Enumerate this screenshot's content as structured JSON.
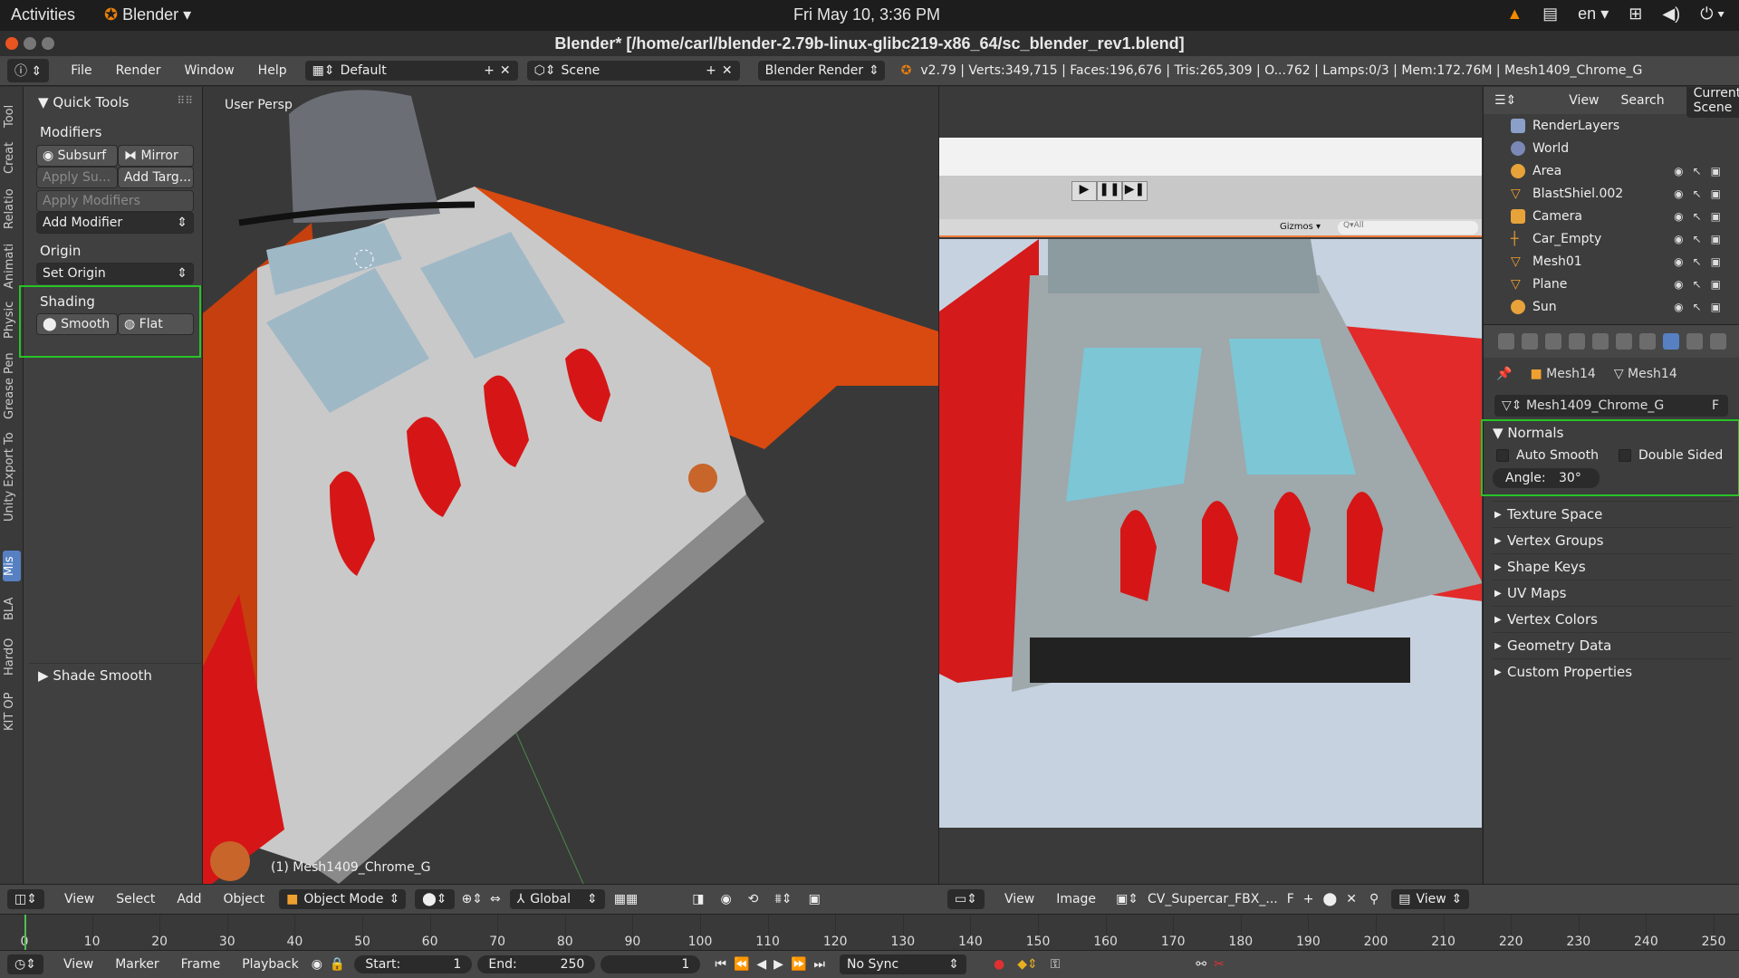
{
  "topbar": {
    "activities": "Activities",
    "app": "Blender",
    "clock": "Fri May 10,  3:36 PM",
    "lang": "en"
  },
  "window": {
    "title": "Blender* [/home/carl/blender-2.79b-linux-glibc219-x86_64/sc_blender_rev1.blend]"
  },
  "info": {
    "menus": [
      "File",
      "Render",
      "Window",
      "Help"
    ],
    "layout": "Default",
    "scene": "Scene",
    "engine": "Blender Render",
    "stats": "v2.79 | Verts:349,715 | Faces:196,676 | Tris:265,309 | O...762 | Lamps:0/3 | Mem:172.76M | Mesh1409_Chrome_G"
  },
  "tool_tabs": [
    "Tool",
    "Creat",
    "Relatio",
    "Animati",
    "Physic",
    "Grease Pen",
    "Unity Export To",
    "Mis",
    "BLA",
    "HardO",
    "KIT OP"
  ],
  "tool_tab_active": "Mis",
  "toolshelf": {
    "panel_title": "Quick Tools",
    "modifiers_label": "Modifiers",
    "subsurf": "Subsurf",
    "mirror": "Mirror",
    "apply_su": "Apply Su...",
    "add_targ": "Add Targ...",
    "apply_modifiers": "Apply Modifiers",
    "add_modifier": "Add Modifier",
    "origin_label": "Origin",
    "set_origin": "Set Origin",
    "shading_label": "Shading",
    "smooth": "Smooth",
    "flat": "Flat",
    "operator_panel": "Shade Smooth"
  },
  "viewport": {
    "view_label": "User Persp",
    "object_label": "(1) Mesh1409_Chrome_G"
  },
  "viewport_header": {
    "menus": [
      "View",
      "Select",
      "Add",
      "Object"
    ],
    "mode": "Object Mode",
    "orientation": "Global"
  },
  "image_header": {
    "menus": [
      "View",
      "Image"
    ],
    "image_name": "CV_Supercar_FBX_...",
    "fake_user": "F",
    "view_label": "View"
  },
  "unity": {
    "gizmos": "Gizmos",
    "search": "Q▾All"
  },
  "outliner": {
    "menus": [
      "View",
      "Search",
      "Current Scene"
    ],
    "items": [
      "RenderLayers",
      "World",
      "Area",
      "BlastShiel.002",
      "Camera",
      "Car_Empty",
      "Mesh01",
      "Plane",
      "Sun"
    ]
  },
  "properties": {
    "context_object": "Mesh14",
    "context_data": "Mesh14",
    "mesh_name": "Mesh1409_Chrome_G",
    "fake_user": "F",
    "normals_title": "Normals",
    "auto_smooth": "Auto Smooth",
    "double_sided": "Double Sided",
    "angle_label": "Angle:",
    "angle_value": "30°",
    "closed_panels": [
      "Texture Space",
      "Vertex Groups",
      "Shape Keys",
      "UV Maps",
      "Vertex Colors",
      "Geometry Data",
      "Custom Properties"
    ]
  },
  "timeline": {
    "ticks": [
      "0",
      "10",
      "20",
      "30",
      "40",
      "50",
      "60",
      "70",
      "80",
      "90",
      "100",
      "110",
      "120",
      "130",
      "140",
      "150",
      "160",
      "170",
      "180",
      "190",
      "200",
      "210",
      "220",
      "230",
      "240",
      "250"
    ],
    "current_frame": 1
  },
  "footer": {
    "menus": [
      "View",
      "Marker",
      "Frame",
      "Playback"
    ],
    "start_label": "Start:",
    "start_value": "1",
    "end_label": "End:",
    "end_value": "250",
    "frame_value": "1",
    "sync": "No Sync"
  },
  "colors": {
    "accent_blue": "#5680c2",
    "highlight_green": "#27c427",
    "header_bg": "#474747"
  }
}
